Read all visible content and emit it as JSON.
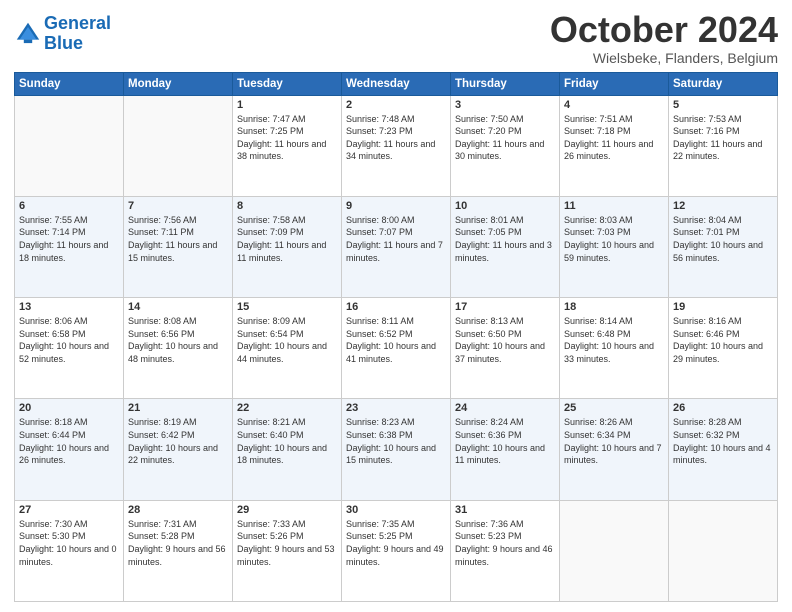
{
  "header": {
    "logo_line1": "General",
    "logo_line2": "Blue",
    "month": "October 2024",
    "location": "Wielsbeke, Flanders, Belgium"
  },
  "days_of_week": [
    "Sunday",
    "Monday",
    "Tuesday",
    "Wednesday",
    "Thursday",
    "Friday",
    "Saturday"
  ],
  "weeks": [
    [
      {
        "day": "",
        "info": ""
      },
      {
        "day": "",
        "info": ""
      },
      {
        "day": "1",
        "info": "Sunrise: 7:47 AM\nSunset: 7:25 PM\nDaylight: 11 hours and 38 minutes."
      },
      {
        "day": "2",
        "info": "Sunrise: 7:48 AM\nSunset: 7:23 PM\nDaylight: 11 hours and 34 minutes."
      },
      {
        "day": "3",
        "info": "Sunrise: 7:50 AM\nSunset: 7:20 PM\nDaylight: 11 hours and 30 minutes."
      },
      {
        "day": "4",
        "info": "Sunrise: 7:51 AM\nSunset: 7:18 PM\nDaylight: 11 hours and 26 minutes."
      },
      {
        "day": "5",
        "info": "Sunrise: 7:53 AM\nSunset: 7:16 PM\nDaylight: 11 hours and 22 minutes."
      }
    ],
    [
      {
        "day": "6",
        "info": "Sunrise: 7:55 AM\nSunset: 7:14 PM\nDaylight: 11 hours and 18 minutes."
      },
      {
        "day": "7",
        "info": "Sunrise: 7:56 AM\nSunset: 7:11 PM\nDaylight: 11 hours and 15 minutes."
      },
      {
        "day": "8",
        "info": "Sunrise: 7:58 AM\nSunset: 7:09 PM\nDaylight: 11 hours and 11 minutes."
      },
      {
        "day": "9",
        "info": "Sunrise: 8:00 AM\nSunset: 7:07 PM\nDaylight: 11 hours and 7 minutes."
      },
      {
        "day": "10",
        "info": "Sunrise: 8:01 AM\nSunset: 7:05 PM\nDaylight: 11 hours and 3 minutes."
      },
      {
        "day": "11",
        "info": "Sunrise: 8:03 AM\nSunset: 7:03 PM\nDaylight: 10 hours and 59 minutes."
      },
      {
        "day": "12",
        "info": "Sunrise: 8:04 AM\nSunset: 7:01 PM\nDaylight: 10 hours and 56 minutes."
      }
    ],
    [
      {
        "day": "13",
        "info": "Sunrise: 8:06 AM\nSunset: 6:58 PM\nDaylight: 10 hours and 52 minutes."
      },
      {
        "day": "14",
        "info": "Sunrise: 8:08 AM\nSunset: 6:56 PM\nDaylight: 10 hours and 48 minutes."
      },
      {
        "day": "15",
        "info": "Sunrise: 8:09 AM\nSunset: 6:54 PM\nDaylight: 10 hours and 44 minutes."
      },
      {
        "day": "16",
        "info": "Sunrise: 8:11 AM\nSunset: 6:52 PM\nDaylight: 10 hours and 41 minutes."
      },
      {
        "day": "17",
        "info": "Sunrise: 8:13 AM\nSunset: 6:50 PM\nDaylight: 10 hours and 37 minutes."
      },
      {
        "day": "18",
        "info": "Sunrise: 8:14 AM\nSunset: 6:48 PM\nDaylight: 10 hours and 33 minutes."
      },
      {
        "day": "19",
        "info": "Sunrise: 8:16 AM\nSunset: 6:46 PM\nDaylight: 10 hours and 29 minutes."
      }
    ],
    [
      {
        "day": "20",
        "info": "Sunrise: 8:18 AM\nSunset: 6:44 PM\nDaylight: 10 hours and 26 minutes."
      },
      {
        "day": "21",
        "info": "Sunrise: 8:19 AM\nSunset: 6:42 PM\nDaylight: 10 hours and 22 minutes."
      },
      {
        "day": "22",
        "info": "Sunrise: 8:21 AM\nSunset: 6:40 PM\nDaylight: 10 hours and 18 minutes."
      },
      {
        "day": "23",
        "info": "Sunrise: 8:23 AM\nSunset: 6:38 PM\nDaylight: 10 hours and 15 minutes."
      },
      {
        "day": "24",
        "info": "Sunrise: 8:24 AM\nSunset: 6:36 PM\nDaylight: 10 hours and 11 minutes."
      },
      {
        "day": "25",
        "info": "Sunrise: 8:26 AM\nSunset: 6:34 PM\nDaylight: 10 hours and 7 minutes."
      },
      {
        "day": "26",
        "info": "Sunrise: 8:28 AM\nSunset: 6:32 PM\nDaylight: 10 hours and 4 minutes."
      }
    ],
    [
      {
        "day": "27",
        "info": "Sunrise: 7:30 AM\nSunset: 5:30 PM\nDaylight: 10 hours and 0 minutes."
      },
      {
        "day": "28",
        "info": "Sunrise: 7:31 AM\nSunset: 5:28 PM\nDaylight: 9 hours and 56 minutes."
      },
      {
        "day": "29",
        "info": "Sunrise: 7:33 AM\nSunset: 5:26 PM\nDaylight: 9 hours and 53 minutes."
      },
      {
        "day": "30",
        "info": "Sunrise: 7:35 AM\nSunset: 5:25 PM\nDaylight: 9 hours and 49 minutes."
      },
      {
        "day": "31",
        "info": "Sunrise: 7:36 AM\nSunset: 5:23 PM\nDaylight: 9 hours and 46 minutes."
      },
      {
        "day": "",
        "info": ""
      },
      {
        "day": "",
        "info": ""
      }
    ]
  ]
}
